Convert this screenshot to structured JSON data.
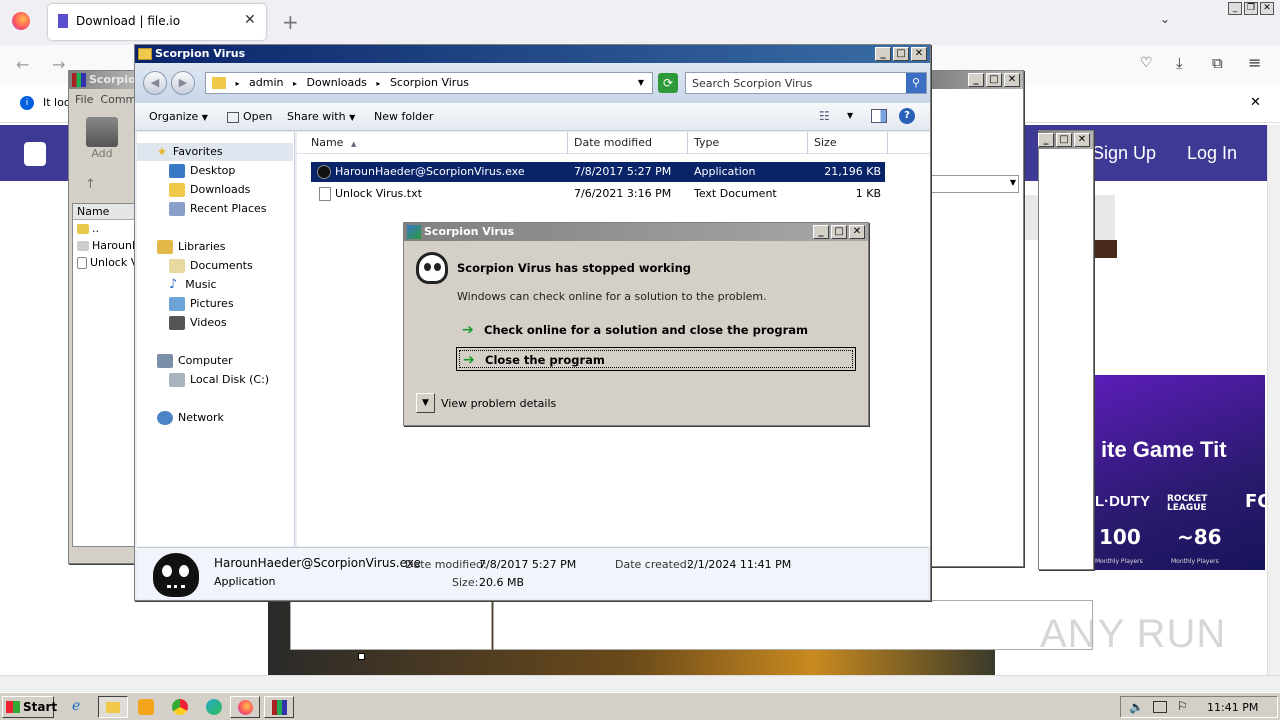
{
  "browser": {
    "tab_title": "Download | file.io",
    "info_text": "It loo",
    "site_buttons": {
      "signup": "Sign Up",
      "login": "Log In"
    },
    "promo": {
      "headline": "ite Game Tit",
      "brand1": "L·DUTY",
      "brand2": "ROCKET LEAGUE",
      "brand3": "FO",
      "stat1": "100",
      "stat1_sub": "Monthly Players",
      "stat2": "~86",
      "stat2_sub": "Monthly Players"
    }
  },
  "winrar": {
    "title": "Scorpio",
    "menu": [
      "File",
      "Comm"
    ],
    "add_label": "Add",
    "column": "Name",
    "rows": [
      "..",
      "HarounH",
      "Unlock V"
    ]
  },
  "explorer": {
    "title": "Scorpion Virus",
    "breadcrumb": [
      "admin",
      "Downloads",
      "Scorpion Virus"
    ],
    "search_placeholder": "Search Scorpion Virus",
    "toolbar": {
      "organize": "Organize",
      "open": "Open",
      "share": "Share with",
      "new_folder": "New folder"
    },
    "tree": [
      {
        "label": "Favorites",
        "level": 0
      },
      {
        "label": "Desktop",
        "level": 1
      },
      {
        "label": "Downloads",
        "level": 1
      },
      {
        "label": "Recent Places",
        "level": 1
      },
      {
        "label": "Libraries",
        "level": 0
      },
      {
        "label": "Documents",
        "level": 1
      },
      {
        "label": "Music",
        "level": 1
      },
      {
        "label": "Pictures",
        "level": 1
      },
      {
        "label": "Videos",
        "level": 1
      },
      {
        "label": "Computer",
        "level": 0
      },
      {
        "label": "Local Disk (C:)",
        "level": 1
      },
      {
        "label": "Network",
        "level": 0
      }
    ],
    "columns": [
      "Name",
      "Date modified",
      "Type",
      "Size"
    ],
    "files": [
      {
        "name": "HarounHaeder@ScorpionVirus.exe",
        "date": "7/8/2017 5:27 PM",
        "type": "Application",
        "size": "21,196 KB",
        "selected": true
      },
      {
        "name": "Unlock Virus.txt",
        "date": "7/6/2021 3:16 PM",
        "type": "Text Document",
        "size": "1 KB",
        "selected": false
      }
    ],
    "details": {
      "filename": "HarounHaeder@ScorpionVirus.exe",
      "filetype": "Application",
      "modified_label": "Date modified:",
      "modified": "7/8/2017 5:27 PM",
      "size_label": "Size:",
      "size": "20.6 MB",
      "created_label": "Date created:",
      "created": "2/1/2024 11:41 PM"
    }
  },
  "dialog": {
    "title": "Scorpion Virus",
    "heading": "Scorpion Virus has stopped working",
    "body": "Windows can check online for a solution to the problem.",
    "option1": "Check online for a solution and close the program",
    "option2": "Close the program",
    "details": "View problem details"
  },
  "taskbar": {
    "start": "Start",
    "time": "11:41 PM"
  },
  "watermark": "ANY RUN"
}
